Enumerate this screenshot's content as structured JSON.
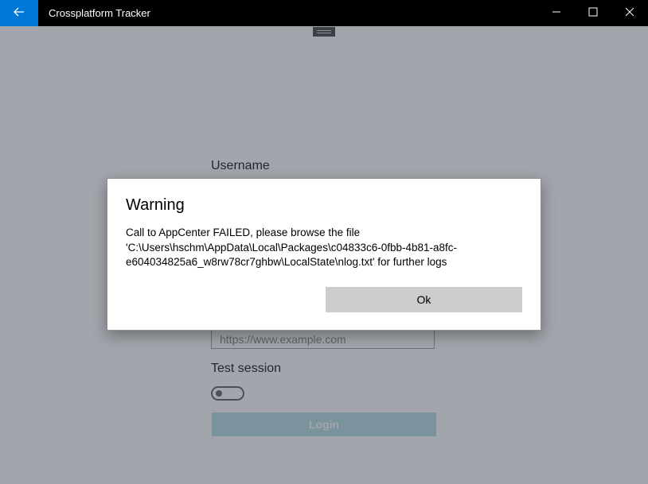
{
  "window": {
    "title": "Crossplatform Tracker",
    "accent_color": "#0078d7",
    "icons": {
      "back": "back-arrow-icon",
      "minimize": "minimize-icon",
      "maximize": "maximize-icon",
      "close": "close-icon"
    }
  },
  "form": {
    "username_label": "Username",
    "url_placeholder": "https://www.example.com",
    "test_session_label": "Test session",
    "test_session_on": false,
    "login_label": "Login"
  },
  "dialog": {
    "title": "Warning",
    "message": "Call to AppCenter FAILED, please browse the file 'C:\\Users\\hschm\\AppData\\Local\\Packages\\c04833c6-0fbb-4b81-a8fc-e604034825a6_w8rw78cr7ghbw\\LocalState\\nlog.txt' for further logs",
    "ok_label": "Ok"
  }
}
